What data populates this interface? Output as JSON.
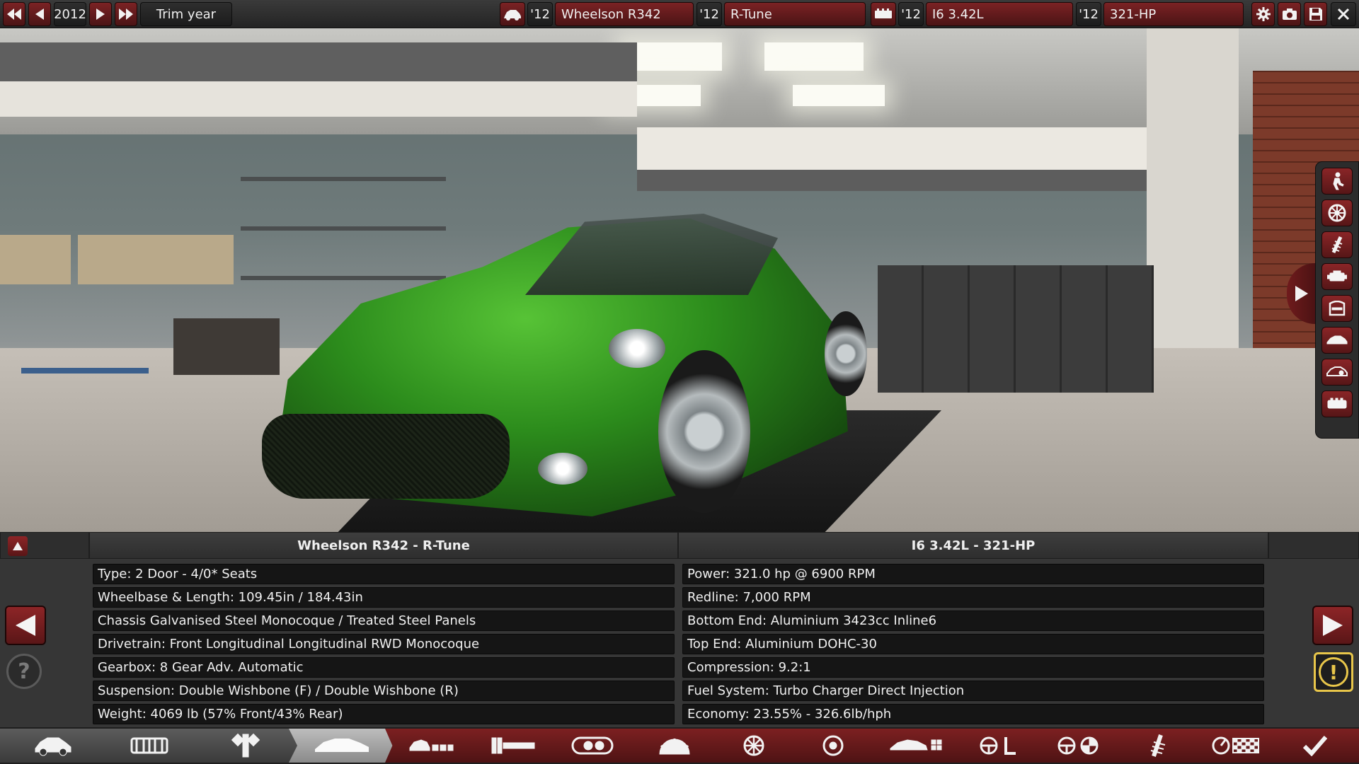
{
  "topbar": {
    "year": "2012",
    "trim_year_label": "Trim year",
    "model_year": "'12",
    "model_name": "Wheelson R342",
    "trim_year": "'12",
    "trim_name": "R-Tune",
    "engine_family_year": "'12",
    "engine_family": "I6 3.42L",
    "engine_variant_year": "'12",
    "engine_variant": "321-HP"
  },
  "panel": {
    "car_title": "Wheelson R342 - R-Tune",
    "engine_title": "I6 3.42L - 321-HP",
    "car_specs": [
      "Type: 2 Door - 4/0* Seats",
      "Wheelbase & Length: 109.45in / 184.43in",
      "Chassis Galvanised Steel Monocoque / Treated Steel Panels",
      "Drivetrain: Front Longitudinal Longitudinal RWD Monocoque",
      "Gearbox: 8 Gear Adv. Automatic",
      "Suspension: Double Wishbone (F) / Double Wishbone (R)",
      "Weight: 4069 lb (57% Front/43% Rear)"
    ],
    "engine_specs": [
      "Power: 321.0 hp @ 6900 RPM",
      "Redline:  7,000 RPM",
      "Bottom End: Aluminium 3423cc Inline6",
      "Top End: Aluminium DOHC-30",
      "Compression: 9.2:1",
      "Fuel System: Turbo Charger Direct Injection",
      "Economy: 23.55% - 326.6lb/hph"
    ]
  },
  "icons": {
    "rightbar": [
      "driver-icon",
      "wheel-icon",
      "suspension-icon",
      "engine-icon",
      "interior-icon",
      "body-icon",
      "lights-icon",
      "fixtures-icon"
    ],
    "bottomnav": [
      "car-icon",
      "chassis-icon",
      "suspension-icon",
      "body-icon",
      "fixtures-icon",
      "gearbox-icon",
      "engine-icon",
      "interior-icon",
      "wheels-icon",
      "brakes-icon",
      "aero-icon",
      "steering-icon",
      "wheel-balance-icon",
      "springs-icon",
      "test-track-icon",
      "confirm-check-icon"
    ]
  },
  "colors": {
    "accent_red": "#7b2224",
    "car_paint": "#2c8c1c",
    "warning_yellow": "#e8c64a"
  }
}
